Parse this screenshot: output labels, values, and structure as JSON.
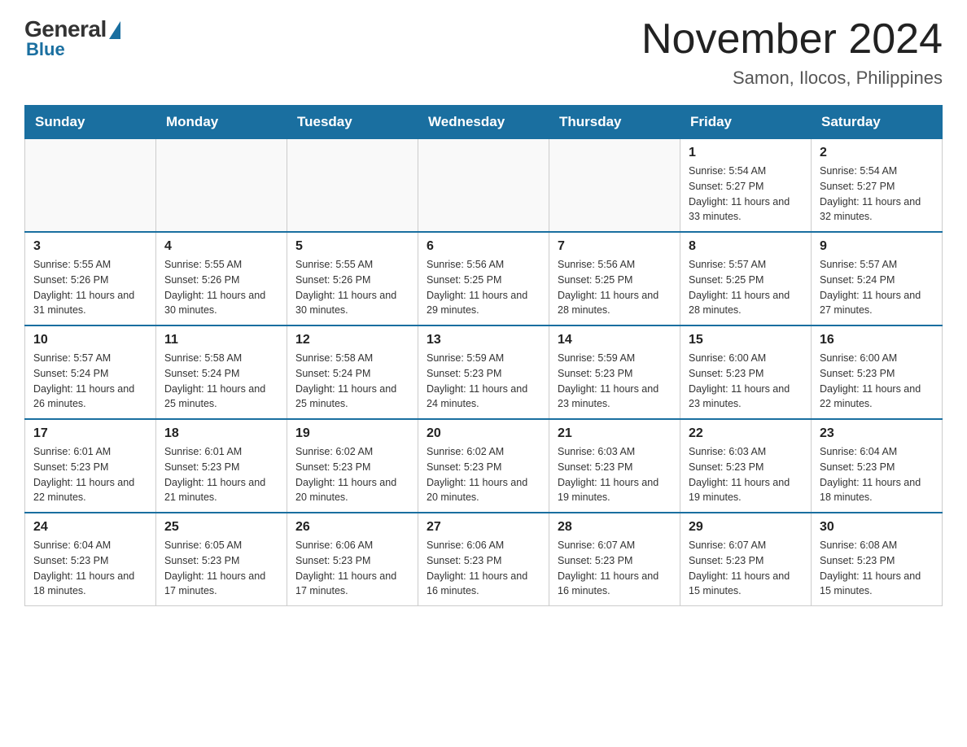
{
  "logo": {
    "general": "General",
    "blue": "Blue"
  },
  "title": "November 2024",
  "subtitle": "Samon, Ilocos, Philippines",
  "days_of_week": [
    "Sunday",
    "Monday",
    "Tuesday",
    "Wednesday",
    "Thursday",
    "Friday",
    "Saturday"
  ],
  "weeks": [
    [
      {
        "day": "",
        "info": ""
      },
      {
        "day": "",
        "info": ""
      },
      {
        "day": "",
        "info": ""
      },
      {
        "day": "",
        "info": ""
      },
      {
        "day": "",
        "info": ""
      },
      {
        "day": "1",
        "info": "Sunrise: 5:54 AM\nSunset: 5:27 PM\nDaylight: 11 hours\nand 33 minutes."
      },
      {
        "day": "2",
        "info": "Sunrise: 5:54 AM\nSunset: 5:27 PM\nDaylight: 11 hours\nand 32 minutes."
      }
    ],
    [
      {
        "day": "3",
        "info": "Sunrise: 5:55 AM\nSunset: 5:26 PM\nDaylight: 11 hours\nand 31 minutes."
      },
      {
        "day": "4",
        "info": "Sunrise: 5:55 AM\nSunset: 5:26 PM\nDaylight: 11 hours\nand 30 minutes."
      },
      {
        "day": "5",
        "info": "Sunrise: 5:55 AM\nSunset: 5:26 PM\nDaylight: 11 hours\nand 30 minutes."
      },
      {
        "day": "6",
        "info": "Sunrise: 5:56 AM\nSunset: 5:25 PM\nDaylight: 11 hours\nand 29 minutes."
      },
      {
        "day": "7",
        "info": "Sunrise: 5:56 AM\nSunset: 5:25 PM\nDaylight: 11 hours\nand 28 minutes."
      },
      {
        "day": "8",
        "info": "Sunrise: 5:57 AM\nSunset: 5:25 PM\nDaylight: 11 hours\nand 28 minutes."
      },
      {
        "day": "9",
        "info": "Sunrise: 5:57 AM\nSunset: 5:24 PM\nDaylight: 11 hours\nand 27 minutes."
      }
    ],
    [
      {
        "day": "10",
        "info": "Sunrise: 5:57 AM\nSunset: 5:24 PM\nDaylight: 11 hours\nand 26 minutes."
      },
      {
        "day": "11",
        "info": "Sunrise: 5:58 AM\nSunset: 5:24 PM\nDaylight: 11 hours\nand 25 minutes."
      },
      {
        "day": "12",
        "info": "Sunrise: 5:58 AM\nSunset: 5:24 PM\nDaylight: 11 hours\nand 25 minutes."
      },
      {
        "day": "13",
        "info": "Sunrise: 5:59 AM\nSunset: 5:23 PM\nDaylight: 11 hours\nand 24 minutes."
      },
      {
        "day": "14",
        "info": "Sunrise: 5:59 AM\nSunset: 5:23 PM\nDaylight: 11 hours\nand 23 minutes."
      },
      {
        "day": "15",
        "info": "Sunrise: 6:00 AM\nSunset: 5:23 PM\nDaylight: 11 hours\nand 23 minutes."
      },
      {
        "day": "16",
        "info": "Sunrise: 6:00 AM\nSunset: 5:23 PM\nDaylight: 11 hours\nand 22 minutes."
      }
    ],
    [
      {
        "day": "17",
        "info": "Sunrise: 6:01 AM\nSunset: 5:23 PM\nDaylight: 11 hours\nand 22 minutes."
      },
      {
        "day": "18",
        "info": "Sunrise: 6:01 AM\nSunset: 5:23 PM\nDaylight: 11 hours\nand 21 minutes."
      },
      {
        "day": "19",
        "info": "Sunrise: 6:02 AM\nSunset: 5:23 PM\nDaylight: 11 hours\nand 20 minutes."
      },
      {
        "day": "20",
        "info": "Sunrise: 6:02 AM\nSunset: 5:23 PM\nDaylight: 11 hours\nand 20 minutes."
      },
      {
        "day": "21",
        "info": "Sunrise: 6:03 AM\nSunset: 5:23 PM\nDaylight: 11 hours\nand 19 minutes."
      },
      {
        "day": "22",
        "info": "Sunrise: 6:03 AM\nSunset: 5:23 PM\nDaylight: 11 hours\nand 19 minutes."
      },
      {
        "day": "23",
        "info": "Sunrise: 6:04 AM\nSunset: 5:23 PM\nDaylight: 11 hours\nand 18 minutes."
      }
    ],
    [
      {
        "day": "24",
        "info": "Sunrise: 6:04 AM\nSunset: 5:23 PM\nDaylight: 11 hours\nand 18 minutes."
      },
      {
        "day": "25",
        "info": "Sunrise: 6:05 AM\nSunset: 5:23 PM\nDaylight: 11 hours\nand 17 minutes."
      },
      {
        "day": "26",
        "info": "Sunrise: 6:06 AM\nSunset: 5:23 PM\nDaylight: 11 hours\nand 17 minutes."
      },
      {
        "day": "27",
        "info": "Sunrise: 6:06 AM\nSunset: 5:23 PM\nDaylight: 11 hours\nand 16 minutes."
      },
      {
        "day": "28",
        "info": "Sunrise: 6:07 AM\nSunset: 5:23 PM\nDaylight: 11 hours\nand 16 minutes."
      },
      {
        "day": "29",
        "info": "Sunrise: 6:07 AM\nSunset: 5:23 PM\nDaylight: 11 hours\nand 15 minutes."
      },
      {
        "day": "30",
        "info": "Sunrise: 6:08 AM\nSunset: 5:23 PM\nDaylight: 11 hours\nand 15 minutes."
      }
    ]
  ]
}
